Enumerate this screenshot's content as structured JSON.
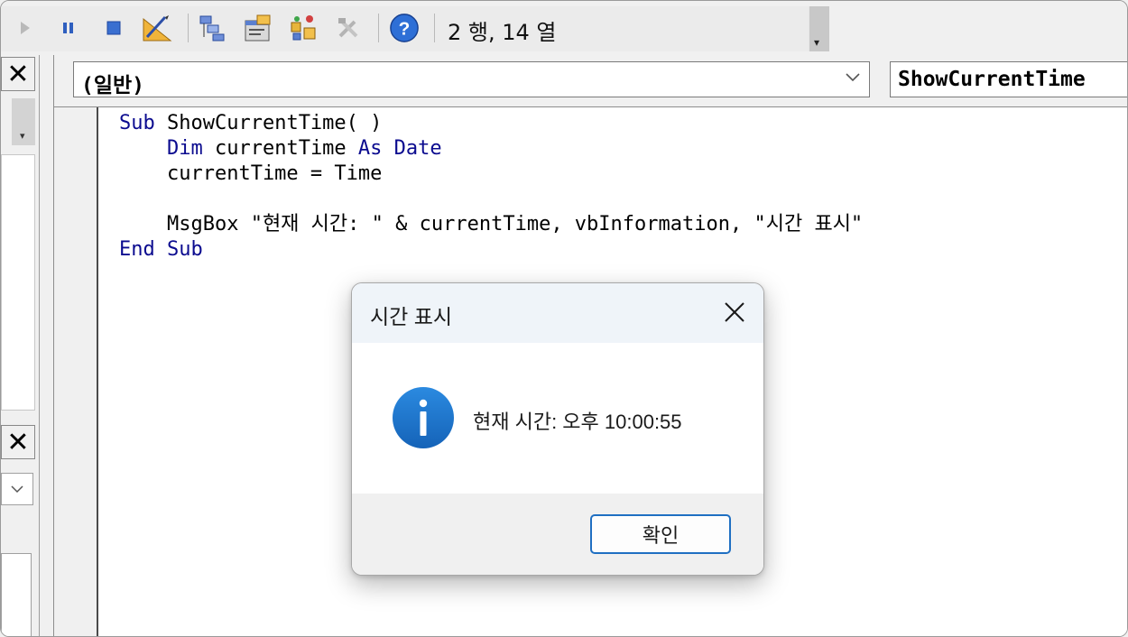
{
  "toolbar": {
    "buttons": [
      {
        "name": "run-icon"
      },
      {
        "name": "pause-icon"
      },
      {
        "name": "stop-icon"
      },
      {
        "name": "design-mode-icon"
      },
      {
        "name": "project-explorer-icon"
      },
      {
        "name": "properties-window-icon"
      },
      {
        "name": "object-browser-icon"
      },
      {
        "name": "toolbox-icon"
      },
      {
        "name": "help-icon"
      }
    ],
    "status": "2 행, 14 열"
  },
  "code_window": {
    "object_combo": "(일반)",
    "procedure_combo": "ShowCurrentTime",
    "code_lines": [
      [
        {
          "t": "Sub",
          "kw": true
        },
        {
          "t": " ShowCurrentTime( )"
        }
      ],
      [
        {
          "t": "    "
        },
        {
          "t": "Dim",
          "kw": true
        },
        {
          "t": " currentTime "
        },
        {
          "t": "As",
          "kw": true
        },
        {
          "t": " "
        },
        {
          "t": "Date",
          "kw": true
        }
      ],
      [
        {
          "t": "    currentTime = Time"
        }
      ],
      [
        {
          "t": ""
        }
      ],
      [
        {
          "t": "    MsgBox \"현재 시간: \" & currentTime, vbInformation, \"시간 표시\""
        }
      ],
      [
        {
          "t": "End",
          "kw": true
        },
        {
          "t": " "
        },
        {
          "t": "Sub",
          "kw": true
        }
      ]
    ]
  },
  "dialog": {
    "title": "시간 표시",
    "message": "현재 시간: 오후 10:00:55",
    "ok_label": "확인",
    "icon": "information-icon"
  },
  "colors": {
    "keyword": "#0b0b8f",
    "accent": "#1f6fc2",
    "info_icon": "#1b78d0"
  }
}
